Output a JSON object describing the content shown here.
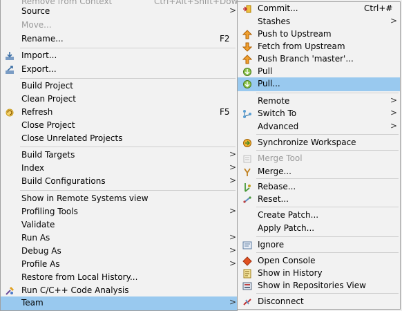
{
  "left_menu": {
    "items": [
      {
        "label": "Remove from Context",
        "accel": "Ctrl+Alt+Shift+Down",
        "disabled": true
      },
      {
        "label": "Source",
        "submenu": true
      },
      {
        "label": "Move...",
        "disabled": true
      },
      {
        "label": "Rename...",
        "accel": "F2"
      },
      {
        "label": "Import...",
        "icon": "import-icon"
      },
      {
        "label": "Export...",
        "icon": "export-icon"
      },
      {
        "label": "Build Project"
      },
      {
        "label": "Clean Project"
      },
      {
        "label": "Refresh",
        "accel": "F5",
        "icon": "refresh-icon"
      },
      {
        "label": "Close Project"
      },
      {
        "label": "Close Unrelated Projects"
      },
      {
        "label": "Build Targets",
        "submenu": true
      },
      {
        "label": "Index",
        "submenu": true
      },
      {
        "label": "Build Configurations",
        "submenu": true
      },
      {
        "label": "Show in Remote Systems view"
      },
      {
        "label": "Profiling Tools",
        "submenu": true
      },
      {
        "label": "Validate"
      },
      {
        "label": "Run As",
        "submenu": true
      },
      {
        "label": "Debug As",
        "submenu": true
      },
      {
        "label": "Profile As",
        "submenu": true
      },
      {
        "label": "Restore from Local History..."
      },
      {
        "label": "Run C/C++ Code Analysis",
        "icon": "code-analysis-icon"
      },
      {
        "label": "Team",
        "submenu": true,
        "selected": true
      }
    ],
    "submenu_arrow": ">"
  },
  "team_menu": {
    "items": [
      {
        "label": "Commit...",
        "accel": "Ctrl+#",
        "icon": "commit-icon"
      },
      {
        "label": "Stashes",
        "submenu": true
      },
      {
        "label": "Push to Upstream",
        "icon": "push-upstream-icon"
      },
      {
        "label": "Fetch from Upstream",
        "icon": "fetch-upstream-icon"
      },
      {
        "label": "Push Branch 'master'...",
        "icon": "push-branch-icon"
      },
      {
        "label": "Pull",
        "icon": "pull-icon"
      },
      {
        "label": "Pull...",
        "icon": "pull-dialog-icon",
        "selected": true
      },
      {
        "label": "Remote",
        "submenu": true
      },
      {
        "label": "Switch To",
        "submenu": true,
        "icon": "switch-to-icon"
      },
      {
        "label": "Advanced",
        "submenu": true
      },
      {
        "label": "Synchronize Workspace",
        "icon": "synchronize-icon"
      },
      {
        "label": "Merge Tool",
        "disabled": true,
        "icon": "merge-tool-icon"
      },
      {
        "label": "Merge...",
        "icon": "merge-icon"
      },
      {
        "label": "Rebase...",
        "icon": "rebase-icon"
      },
      {
        "label": "Reset...",
        "icon": "reset-icon"
      },
      {
        "label": "Create Patch..."
      },
      {
        "label": "Apply Patch..."
      },
      {
        "label": "Ignore",
        "icon": "ignore-icon"
      },
      {
        "label": "Open Console",
        "icon": "console-icon"
      },
      {
        "label": "Show in History",
        "icon": "history-icon"
      },
      {
        "label": "Show in Repositories View",
        "icon": "repositories-icon"
      },
      {
        "label": "Disconnect",
        "icon": "disconnect-icon"
      }
    ],
    "submenu_arrow": ">"
  },
  "colors": {
    "selection": "#99c9ef",
    "menu_bg": "#f2f2f2",
    "disabled_text": "#9a9a9a"
  }
}
